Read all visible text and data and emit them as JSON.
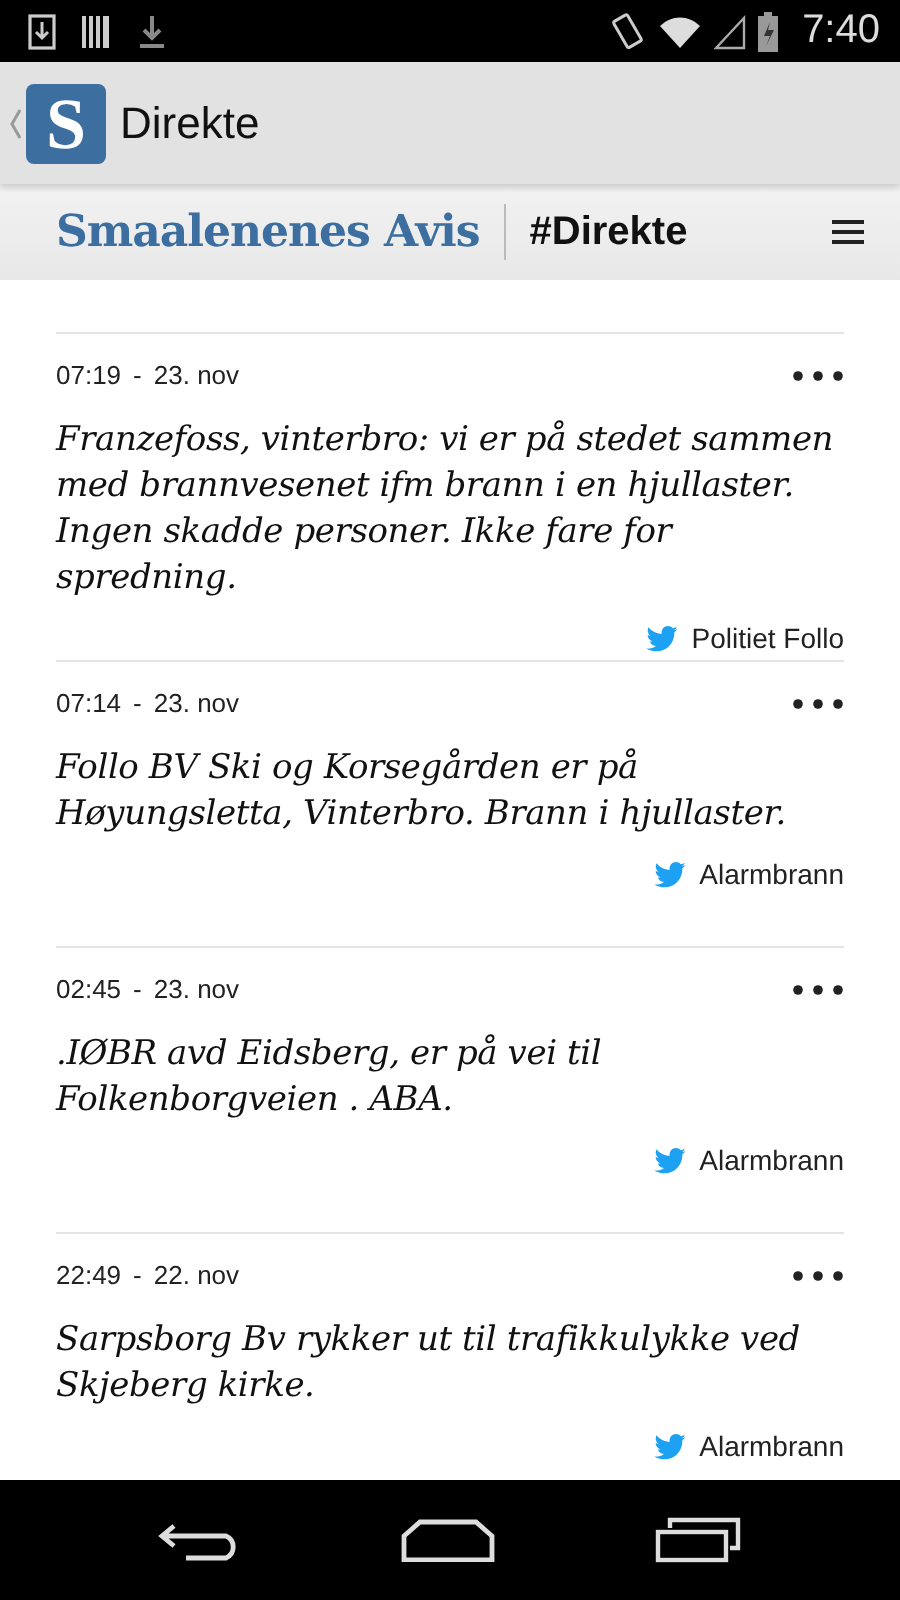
{
  "status_bar": {
    "time": "7:40"
  },
  "action_bar": {
    "app_icon_letter": "S",
    "title": "Direkte"
  },
  "masthead": {
    "logo": "Smaalenenes Avis",
    "section": "#Direkte"
  },
  "posts": [
    {
      "time": "07:19",
      "separator": "-",
      "date": "23. nov",
      "text": "Franzefoss, vinterbro: vi er på stedet sammen med brannvesenet ifm brann i en hjullaster. Ingen skadde personer. Ikke fare for spredning.",
      "source": "Politiet Follo"
    },
    {
      "time": "07:14",
      "separator": "-",
      "date": "23. nov",
      "text": "Follo BV Ski og Korsegården er på Høyungsletta, Vinterbro. Brann i hjullaster.",
      "source": "Alarmbrann"
    },
    {
      "time": "02:45",
      "separator": "-",
      "date": "23. nov",
      "text": ".IØBR avd Eidsberg, er på vei til Folkenborgveien . ABA.",
      "source": "Alarmbrann"
    },
    {
      "time": "22:49",
      "separator": "-",
      "date": "22. nov",
      "text": "Sarpsborg Bv rykker ut til trafikkulykke ved Skjeberg kirke.",
      "source": "Alarmbrann"
    }
  ]
}
